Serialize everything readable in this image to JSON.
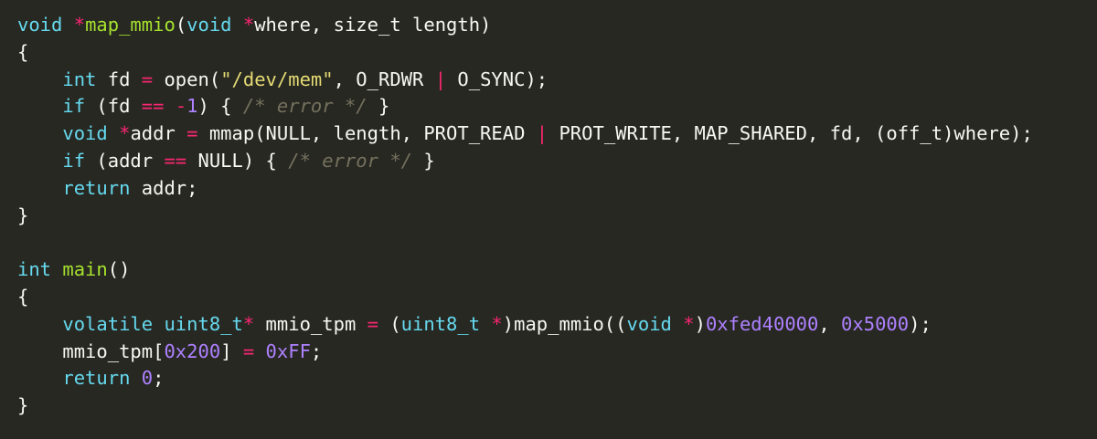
{
  "theme": {
    "background": "#272822",
    "text": "#f8f8f2",
    "keyword": "#66d9ef",
    "function": "#a6e22e",
    "operator": "#f92672",
    "string": "#e6db74",
    "number": "#ae81ff",
    "comment": "#75715e"
  },
  "code": {
    "lines": [
      [
        [
          "kw",
          "void"
        ],
        [
          "p",
          " "
        ],
        [
          "op",
          "*"
        ],
        [
          "fn",
          "map_mmio"
        ],
        [
          "p",
          "("
        ],
        [
          "kw",
          "void"
        ],
        [
          "p",
          " "
        ],
        [
          "op",
          "*"
        ],
        [
          "p",
          "where, size_t length)"
        ]
      ],
      [
        [
          "p",
          "{"
        ]
      ],
      [
        [
          "p",
          "    "
        ],
        [
          "kw",
          "int"
        ],
        [
          "p",
          " fd "
        ],
        [
          "op",
          "="
        ],
        [
          "p",
          " open("
        ],
        [
          "str",
          "\"/dev/mem\""
        ],
        [
          "p",
          ", O_RDWR "
        ],
        [
          "op",
          "|"
        ],
        [
          "p",
          " O_SYNC);"
        ]
      ],
      [
        [
          "p",
          "    "
        ],
        [
          "kw",
          "if"
        ],
        [
          "p",
          " (fd "
        ],
        [
          "op",
          "=="
        ],
        [
          "p",
          " "
        ],
        [
          "op",
          "-"
        ],
        [
          "num",
          "1"
        ],
        [
          "p",
          ") { "
        ],
        [
          "cm",
          "/* error */"
        ],
        [
          "p",
          " }"
        ]
      ],
      [
        [
          "p",
          "    "
        ],
        [
          "kw",
          "void"
        ],
        [
          "p",
          " "
        ],
        [
          "op",
          "*"
        ],
        [
          "p",
          "addr "
        ],
        [
          "op",
          "="
        ],
        [
          "p",
          " mmap(NULL, length, PROT_READ "
        ],
        [
          "op",
          "|"
        ],
        [
          "p",
          " PROT_WRITE, MAP_SHARED, fd, (off_t)where);"
        ]
      ],
      [
        [
          "p",
          "    "
        ],
        [
          "kw",
          "if"
        ],
        [
          "p",
          " (addr "
        ],
        [
          "op",
          "=="
        ],
        [
          "p",
          " NULL) { "
        ],
        [
          "cm",
          "/* error */"
        ],
        [
          "p",
          " }"
        ]
      ],
      [
        [
          "p",
          "    "
        ],
        [
          "kw",
          "return"
        ],
        [
          "p",
          " addr;"
        ]
      ],
      [
        [
          "p",
          "}"
        ]
      ],
      [],
      [
        [
          "kw",
          "int"
        ],
        [
          "p",
          " "
        ],
        [
          "fn",
          "main"
        ],
        [
          "p",
          "()"
        ]
      ],
      [
        [
          "p",
          "{"
        ]
      ],
      [
        [
          "p",
          "    "
        ],
        [
          "kw",
          "volatile"
        ],
        [
          "p",
          " "
        ],
        [
          "kw",
          "uint8_t"
        ],
        [
          "op",
          "*"
        ],
        [
          "p",
          " mmio_tpm "
        ],
        [
          "op",
          "="
        ],
        [
          "p",
          " ("
        ],
        [
          "kw",
          "uint8_t"
        ],
        [
          "p",
          " "
        ],
        [
          "op",
          "*"
        ],
        [
          "p",
          ")map_mmio(("
        ],
        [
          "kw",
          "void"
        ],
        [
          "p",
          " "
        ],
        [
          "op",
          "*"
        ],
        [
          "p",
          ")"
        ],
        [
          "num",
          "0xfed40000"
        ],
        [
          "p",
          ", "
        ],
        [
          "num",
          "0x5000"
        ],
        [
          "p",
          ");"
        ]
      ],
      [
        [
          "p",
          "    mmio_tpm["
        ],
        [
          "num",
          "0x200"
        ],
        [
          "p",
          "] "
        ],
        [
          "op",
          "="
        ],
        [
          "p",
          " "
        ],
        [
          "num",
          "0xFF"
        ],
        [
          "p",
          ";"
        ]
      ],
      [
        [
          "p",
          "    "
        ],
        [
          "kw",
          "return"
        ],
        [
          "p",
          " "
        ],
        [
          "num",
          "0"
        ],
        [
          "p",
          ";"
        ]
      ],
      [
        [
          "p",
          "}"
        ]
      ]
    ]
  }
}
